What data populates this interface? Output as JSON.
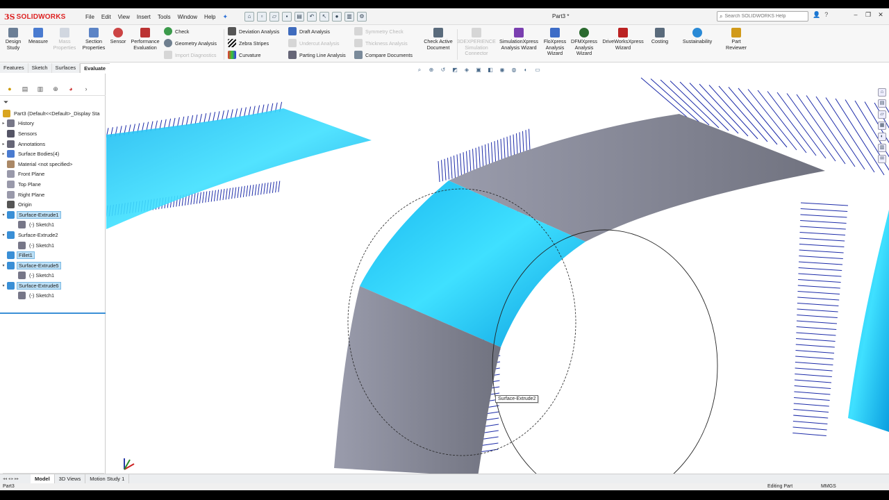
{
  "app": {
    "brand": "SOLIDWORKS",
    "document_title": "Part3 *",
    "search_placeholder": "Search SOLIDWORKS Help"
  },
  "menu": [
    "File",
    "Edit",
    "View",
    "Insert",
    "Tools",
    "Window",
    "Help"
  ],
  "ribbon": {
    "design_study": "Design Study",
    "measure": "Measure",
    "mass_properties": "Mass Properties",
    "section_properties": "Section Properties",
    "sensor": "Sensor",
    "performance_evaluation": "Performance Evaluation",
    "check": "Check",
    "geometry_analysis": "Geometry Analysis",
    "import_diagnostics": "Import Diagnostics",
    "deviation_analysis": "Deviation Analysis",
    "zebra_stripes": "Zebra Stripes",
    "curvature": "Curvature",
    "draft_analysis": "Draft Analysis",
    "undercut_analysis": "Undercut Analysis",
    "parting_line_analysis": "Parting Line Analysis",
    "symmetry_check": "Symmetry Check",
    "thickness_analysis": "Thickness Analysis",
    "compare_documents": "Compare Documents",
    "check_active_document": "Check Active Document",
    "experience_sim": "3DEXPERIENCE Simulation Connector",
    "simulationxpress": "SimulationXpress Analysis Wizard",
    "floxpress": "FloXpress Analysis Wizard",
    "dfmxpress": "DFMXpress Analysis Wizard",
    "driveworksxpress": "DriveWorksXpress Wizard",
    "costing": "Costing",
    "sustainability": "Sustainability",
    "part_reviewer": "Part Reviewer"
  },
  "command_tabs": [
    "Features",
    "Sketch",
    "Surfaces",
    "Evaluate"
  ],
  "tree": {
    "root": "Part3  (Default<<Default>_Display Sta",
    "items": [
      {
        "label": "History",
        "arrow": "▸",
        "sel": false,
        "indent": 0
      },
      {
        "label": "Sensors",
        "arrow": "",
        "sel": false,
        "indent": 0
      },
      {
        "label": "Annotations",
        "arrow": "▸",
        "sel": false,
        "indent": 0
      },
      {
        "label": "Surface Bodies(4)",
        "arrow": "▸",
        "sel": false,
        "indent": 0
      },
      {
        "label": "Material <not specified>",
        "arrow": "",
        "sel": false,
        "indent": 0
      },
      {
        "label": "Front Plane",
        "arrow": "",
        "sel": false,
        "indent": 0
      },
      {
        "label": "Top Plane",
        "arrow": "",
        "sel": false,
        "indent": 0
      },
      {
        "label": "Right Plane",
        "arrow": "",
        "sel": false,
        "indent": 0
      },
      {
        "label": "Origin",
        "arrow": "",
        "sel": false,
        "indent": 0
      },
      {
        "label": "Surface-Extrude1",
        "arrow": "▾",
        "sel": true,
        "indent": 0
      },
      {
        "label": "(-) Sketch1",
        "arrow": "",
        "sel": false,
        "indent": 1
      },
      {
        "label": "Surface-Extrude2",
        "arrow": "▾",
        "sel": false,
        "indent": 0
      },
      {
        "label": "(-) Sketch1",
        "arrow": "",
        "sel": false,
        "indent": 1
      },
      {
        "label": "Fillet1",
        "arrow": "",
        "sel": true,
        "indent": 0
      },
      {
        "label": "Surface-Extrude5",
        "arrow": "▾",
        "sel": true,
        "indent": 0
      },
      {
        "label": "(-) Sketch1",
        "arrow": "",
        "sel": false,
        "indent": 1
      },
      {
        "label": "Surface-Extrude6",
        "arrow": "▾",
        "sel": true,
        "indent": 0
      },
      {
        "label": "(-) Sketch1",
        "arrow": "",
        "sel": false,
        "indent": 1
      }
    ]
  },
  "viewport": {
    "tooltip": "Surface-Extrude2",
    "surface_color": "#19c4f5",
    "gray_color": "#8a8c9c",
    "comb_color": "#1b2aa8"
  },
  "model_tabs": [
    "Model",
    "3D Views",
    "Motion Study 1"
  ],
  "status": {
    "document": "Part3",
    "mode": "Editing Part",
    "units": "MMGS"
  }
}
